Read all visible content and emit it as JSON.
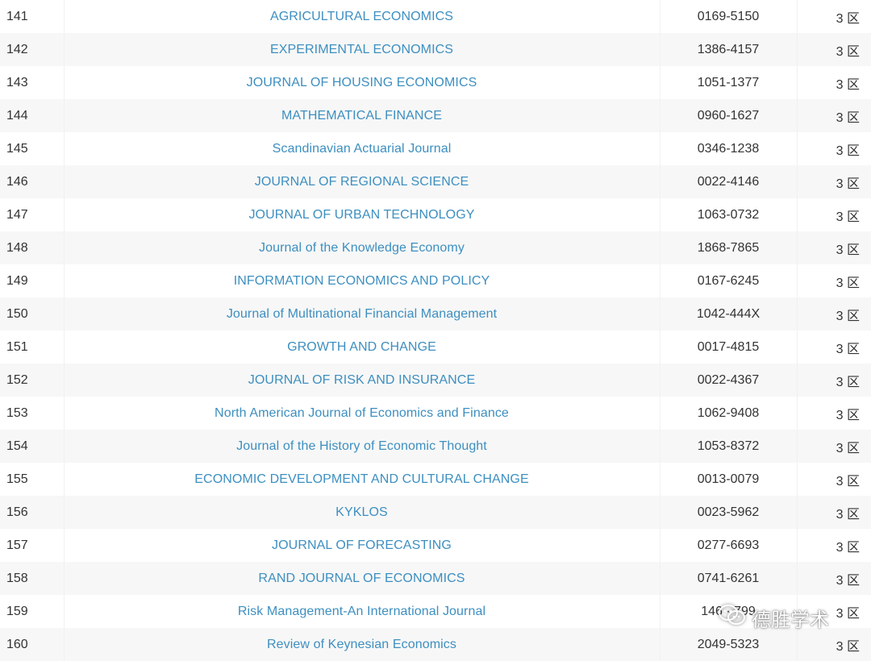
{
  "journals": [
    {
      "rank": "141",
      "title": "AGRICULTURAL ECONOMICS",
      "issn": "0169-5150",
      "zone": "3 区"
    },
    {
      "rank": "142",
      "title": "EXPERIMENTAL ECONOMICS",
      "issn": "1386-4157",
      "zone": "3 区"
    },
    {
      "rank": "143",
      "title": "JOURNAL OF HOUSING ECONOMICS",
      "issn": "1051-1377",
      "zone": "3 区"
    },
    {
      "rank": "144",
      "title": "MATHEMATICAL FINANCE",
      "issn": "0960-1627",
      "zone": "3 区"
    },
    {
      "rank": "145",
      "title": "Scandinavian Actuarial Journal",
      "issn": "0346-1238",
      "zone": "3 区"
    },
    {
      "rank": "146",
      "title": "JOURNAL OF REGIONAL SCIENCE",
      "issn": "0022-4146",
      "zone": "3 区"
    },
    {
      "rank": "147",
      "title": "JOURNAL OF URBAN TECHNOLOGY",
      "issn": "1063-0732",
      "zone": "3 区"
    },
    {
      "rank": "148",
      "title": "Journal of the Knowledge Economy",
      "issn": "1868-7865",
      "zone": "3 区"
    },
    {
      "rank": "149",
      "title": "INFORMATION ECONOMICS AND POLICY",
      "issn": "0167-6245",
      "zone": "3 区"
    },
    {
      "rank": "150",
      "title": "Journal of Multinational Financial Management",
      "issn": "1042-444X",
      "zone": "3 区"
    },
    {
      "rank": "151",
      "title": "GROWTH AND CHANGE",
      "issn": "0017-4815",
      "zone": "3 区"
    },
    {
      "rank": "152",
      "title": "JOURNAL OF RISK AND INSURANCE",
      "issn": "0022-4367",
      "zone": "3 区"
    },
    {
      "rank": "153",
      "title": "North American Journal of Economics and Finance",
      "issn": "1062-9408",
      "zone": "3 区"
    },
    {
      "rank": "154",
      "title": "Journal of the History of Economic Thought",
      "issn": "1053-8372",
      "zone": "3 区"
    },
    {
      "rank": "155",
      "title": "ECONOMIC DEVELOPMENT AND CULTURAL CHANGE",
      "issn": "0013-0079",
      "zone": "3 区"
    },
    {
      "rank": "156",
      "title": "KYKLOS",
      "issn": "0023-5962",
      "zone": "3 区"
    },
    {
      "rank": "157",
      "title": "JOURNAL OF FORECASTING",
      "issn": "0277-6693",
      "zone": "3 区"
    },
    {
      "rank": "158",
      "title": "RAND JOURNAL OF ECONOMICS",
      "issn": "0741-6261",
      "zone": "3 区"
    },
    {
      "rank": "159",
      "title": "Risk Management-An International Journal",
      "issn": "146 · 799",
      "zone": "3 区"
    },
    {
      "rank": "160",
      "title": "Review of Keynesian Economics",
      "issn": "2049-5323",
      "zone": "3 区"
    }
  ],
  "colors": {
    "link": "#3d8fc0",
    "text": "#333333",
    "stripe": "#f7f7f7"
  },
  "watermark": {
    "icon": "wechat-icon",
    "text": "德胜学术"
  }
}
